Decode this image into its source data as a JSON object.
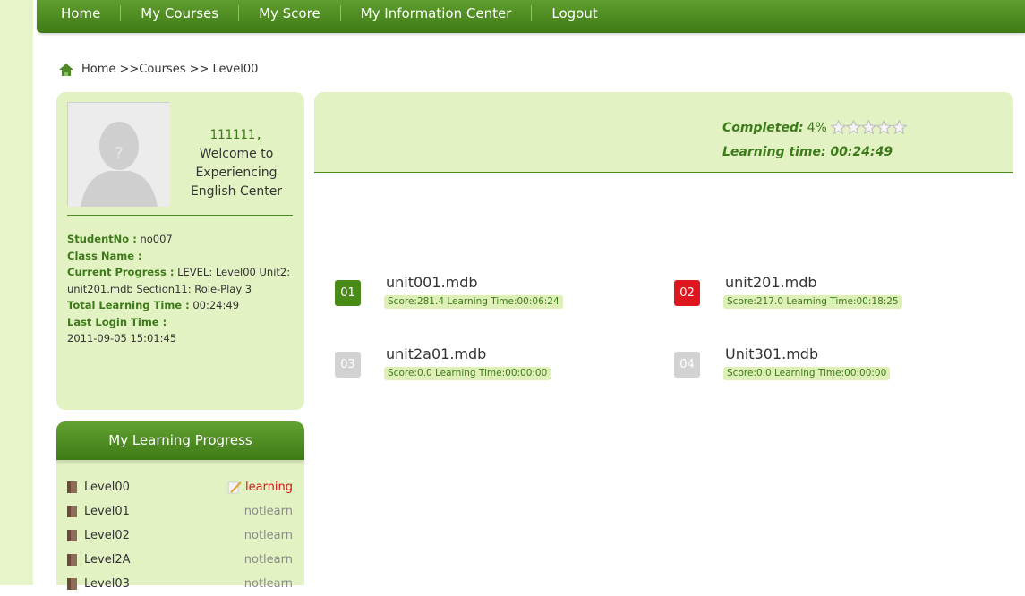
{
  "nav": {
    "items": [
      "Home",
      "My Courses",
      "My Score",
      "My Information Center",
      "Logout"
    ]
  },
  "breadcrumb": "Home >>Courses >> Level00",
  "profile": {
    "user_id": "111111,",
    "welcome": "Welcome to Experiencing English Center",
    "student_no_label": "StudentNo :",
    "student_no": "no007",
    "class_name_label": "Class Name :",
    "class_name": "",
    "current_progress_label": "Current Progress :",
    "current_progress": "LEVEL: Level00 Unit2: unit201.mdb Section11: Role-Play 3",
    "total_time_label": "Total Learning Time :",
    "total_time": "00:24:49",
    "last_login_label": "Last Login Time :",
    "last_login": "2011-09-05 15:01:45"
  },
  "progress_panel": {
    "title": "My Learning Progress",
    "levels": [
      {
        "name": "Level00",
        "status": "learning"
      },
      {
        "name": "Level01",
        "status": "notlearn"
      },
      {
        "name": "Level02",
        "status": "notlearn"
      },
      {
        "name": "Level2A",
        "status": "notlearn"
      },
      {
        "name": "Level03",
        "status": "notlearn"
      }
    ]
  },
  "summary": {
    "completed_label": "Completed:",
    "completed_value": "4%",
    "stars_filled": 0,
    "stars_total": 5,
    "time_label": "Learning time:",
    "time_value": "00:24:49"
  },
  "units": [
    {
      "num": "01",
      "name": "unit001.mdb",
      "score": "Score:281.4 Learning Time:00:06:24",
      "color": "#4a8a18"
    },
    {
      "num": "02",
      "name": "unit201.mdb",
      "score": "Score:217.0 Learning Time:00:18:25",
      "color": "#e0161e"
    },
    {
      "num": "03",
      "name": "unit2a01.mdb",
      "score": "Score:0.0 Learning Time:00:00:00",
      "color": "#d2d2d2"
    },
    {
      "num": "04",
      "name": "Unit301.mdb",
      "score": "Score:0.0 Learning Time:00:00:00",
      "color": "#d2d2d2"
    }
  ],
  "colors": {
    "accent_green": "#3d7a1a",
    "panel_bg": "#e3f2c3",
    "alert_red": "#d01818"
  },
  "icons": [
    "home-icon",
    "avatar-placeholder",
    "star-icon",
    "book-icon",
    "pencil-icon"
  ]
}
